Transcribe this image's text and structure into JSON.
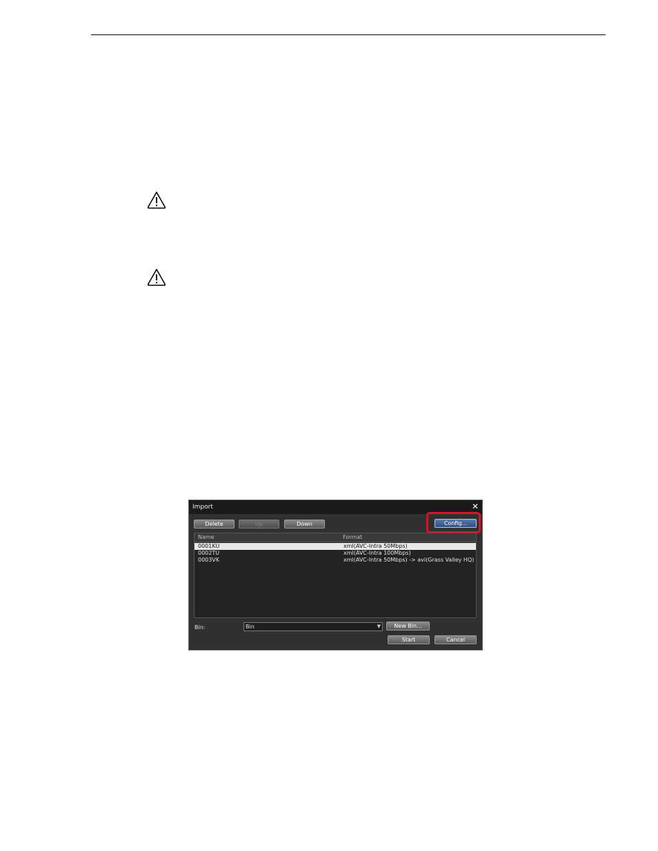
{
  "dialog": {
    "title": "Import",
    "close_glyph": "✕",
    "buttons": {
      "delete": "Delete",
      "up": "Up",
      "down": "Down",
      "config": "Config...",
      "new_bin": "New Bin...",
      "start": "Start",
      "cancel": "Cancel"
    },
    "list": {
      "columns": {
        "name": "Name",
        "format": "Format"
      },
      "rows": [
        {
          "name": "0001KU",
          "format": "xml(AVC-Intra 50Mbps)"
        },
        {
          "name": "0002TU",
          "format": "xml(AVC-Intra 100Mbps)"
        },
        {
          "name": "0003VK",
          "format": "xml(AVC-Intra 50Mbps) -> avi(Grass Valley HQ)"
        }
      ]
    },
    "bin": {
      "label": "Bin:",
      "value": "Bin"
    }
  },
  "icons": {
    "warning": "warning-icon",
    "dropdown": "chevron-down-icon",
    "close": "close-icon"
  },
  "colors": {
    "highlight": "#e0102a",
    "dialog_background": "#303030",
    "titlebar": "#1a1a1a"
  }
}
